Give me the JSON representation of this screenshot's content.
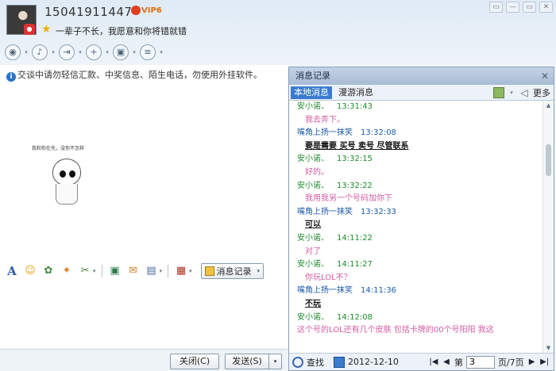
{
  "contact": {
    "phone": "15041911447",
    "vip_label": "VIP6",
    "signature": "一辈子不长，我愿意和你将错就错"
  },
  "window_buttons": [
    "▭",
    "—",
    "▭",
    "✕"
  ],
  "toolbar_icons": [
    {
      "name": "video-call-icon",
      "glyph": "◉"
    },
    {
      "name": "voice-call-icon",
      "glyph": "♪"
    },
    {
      "name": "file-transfer-icon",
      "glyph": "⇥"
    },
    {
      "name": "add-member-icon",
      "glyph": "+"
    },
    {
      "name": "remote-desktop-icon",
      "glyph": "▣"
    },
    {
      "name": "app-menu-icon",
      "glyph": "≡"
    }
  ],
  "notice": "交谈中请勿轻信汇款、中奖信息、陌生电话，勿使用外挂软件。",
  "sketch_caption": "我和你在先，没你不怎样",
  "format_toolbar": {
    "history_button_label": "消息记录"
  },
  "buttons": {
    "close": "关闭(C)",
    "send": "发送(S)"
  },
  "history": {
    "title": "消息记录",
    "close_glyph": "✕",
    "tabs": [
      "本地消息",
      "漫游消息"
    ],
    "more_label": "更多",
    "messages": [
      {
        "kind": "head-a",
        "sender": "安小诺、",
        "time": "13:31:43"
      },
      {
        "kind": "pink",
        "text": "我去弄下。"
      },
      {
        "kind": "head-b",
        "sender": "嘴角上扬一抹笑",
        "time": "13:32:08"
      },
      {
        "kind": "bold",
        "text": "要是需要 买号 卖号 尽管联系"
      },
      {
        "kind": "head-a",
        "sender": "安小诺、",
        "time": "13:32:15"
      },
      {
        "kind": "pink",
        "text": "好的。"
      },
      {
        "kind": "head-a",
        "sender": "安小诺、",
        "time": "13:32:22"
      },
      {
        "kind": "pink",
        "text": "我用我另一个号码加你下"
      },
      {
        "kind": "head-b",
        "sender": "嘴角上扬一抹笑",
        "time": "13:32:33"
      },
      {
        "kind": "bold",
        "text": "可以"
      },
      {
        "kind": "head-a",
        "sender": "安小诺、",
        "time": "14:11:22"
      },
      {
        "kind": "pink",
        "text": "对了"
      },
      {
        "kind": "head-a",
        "sender": "安小诺、",
        "time": "14:11:27"
      },
      {
        "kind": "pink",
        "text": "你玩LOL不？"
      },
      {
        "kind": "head-b",
        "sender": "嘴角上扬一抹笑",
        "time": "14:11:36"
      },
      {
        "kind": "bold",
        "text": "不玩"
      },
      {
        "kind": "head-a",
        "sender": "安小诺、",
        "time": "14:12:08"
      },
      {
        "kind": "cut",
        "text": "这个号的LOL还有几个皮肤 包括卡牌的00个号阳阳 我这"
      }
    ],
    "search_label": "查找",
    "date": "2012-12-10",
    "page_prefix": "第",
    "page_value": "3",
    "page_suffix": "页/7页"
  }
}
